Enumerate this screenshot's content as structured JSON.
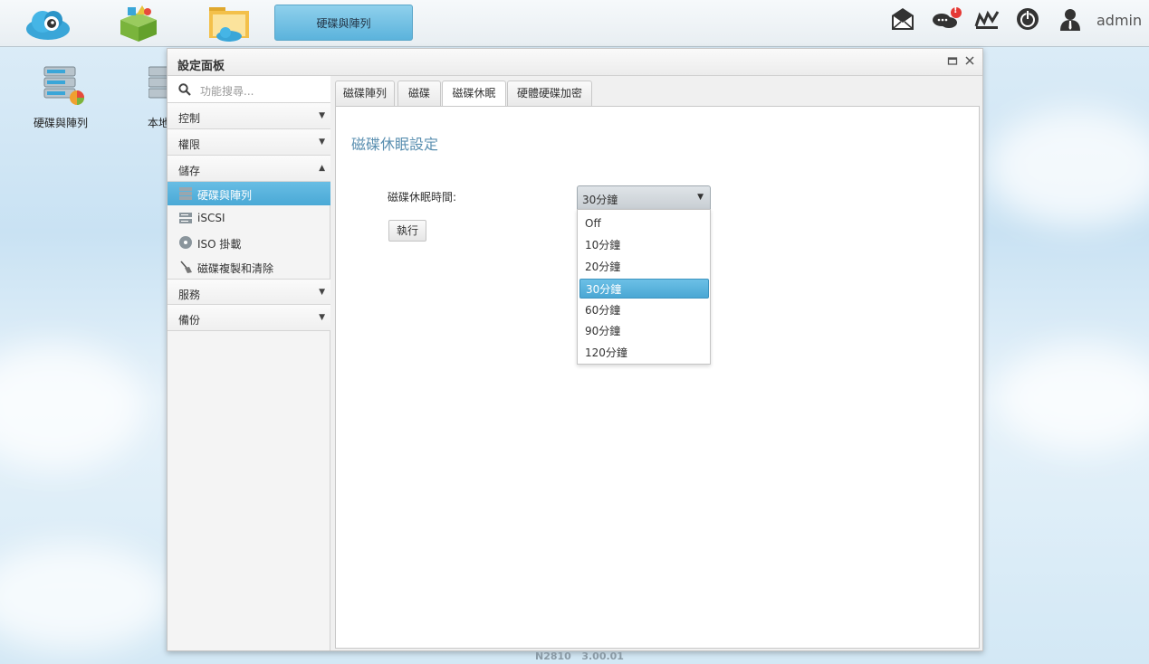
{
  "taskbar": {
    "active_task_label": "硬碟與陣列",
    "user_label": "admin",
    "notification_badge": "!",
    "icons": [
      "cloud-app-icon",
      "app-center-icon",
      "file-manager-icon",
      "mail-icon",
      "chat-icon",
      "monitor-icon",
      "power-icon",
      "user-icon"
    ]
  },
  "desktop": {
    "icons": [
      {
        "label": "硬碟與陣列",
        "icon": "raid-icon"
      },
      {
        "label": "本地",
        "icon": "local-storage-icon"
      }
    ]
  },
  "panel": {
    "title": "設定面板",
    "search_placeholder": "功能搜尋...",
    "categories": [
      {
        "label": "控制",
        "arrow": "▼"
      },
      {
        "label": "權限",
        "arrow": "▼"
      },
      {
        "label": "儲存",
        "arrow": "▲"
      },
      {
        "label": "服務",
        "arrow": "▼"
      },
      {
        "label": "備份",
        "arrow": "▼"
      }
    ],
    "storage_items": [
      {
        "label": "硬碟與陣列",
        "icon": "raid-icon",
        "active": true
      },
      {
        "label": "iSCSI",
        "icon": "iscsi-icon",
        "active": false
      },
      {
        "label": "ISO 掛載",
        "icon": "disc-icon",
        "active": false
      },
      {
        "label": "磁碟複製和清除",
        "icon": "broom-icon",
        "active": false
      }
    ],
    "tabs": [
      {
        "label": "磁碟陣列",
        "selected": false
      },
      {
        "label": "磁碟",
        "selected": false
      },
      {
        "label": "磁碟休眠",
        "selected": true
      },
      {
        "label": "硬體硬碟加密",
        "selected": false
      }
    ],
    "section_title": "磁碟休眠設定",
    "sleep_label": "磁碟休眠時間:",
    "sleep_value": "30分鐘",
    "sleep_options": [
      "Off",
      "10分鐘",
      "20分鐘",
      "30分鐘",
      "60分鐘",
      "90分鐘",
      "120分鐘"
    ],
    "execute_label": "執行"
  },
  "footer": {
    "model": "N2810",
    "version": "3.00.01"
  }
}
